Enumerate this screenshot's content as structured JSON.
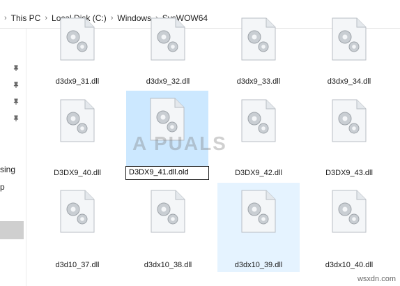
{
  "breadcrumb": {
    "items": [
      "This PC",
      "Local Disk (C:)",
      "Windows",
      "SysWOW64"
    ]
  },
  "nav": {
    "partial_labels": [
      "sing",
      "p"
    ]
  },
  "files": {
    "row1": [
      "d3dx9_31.dll",
      "d3dx9_32.dll",
      "d3dx9_33.dll",
      "d3dx9_34.dll"
    ],
    "row2": [
      "D3DX9_40.dll",
      "D3DX9_41.dll.old",
      "D3DX9_42.dll",
      "D3DX9_43.dll"
    ],
    "row3": [
      "d3d10_37.dll",
      "d3dx10_38.dll",
      "d3dx10_39.dll",
      "d3dx10_40.dll"
    ],
    "rename_value": "D3DX9_41.dll.old"
  },
  "colors": {
    "selected": "#cce8ff",
    "hover": "#e5f3ff"
  },
  "icons": {
    "file": "settings-file-icon",
    "pin": "pin-icon",
    "separator": "chevron-right-icon"
  },
  "watermark": "A PUALS",
  "credit": "wsxdn.com"
}
